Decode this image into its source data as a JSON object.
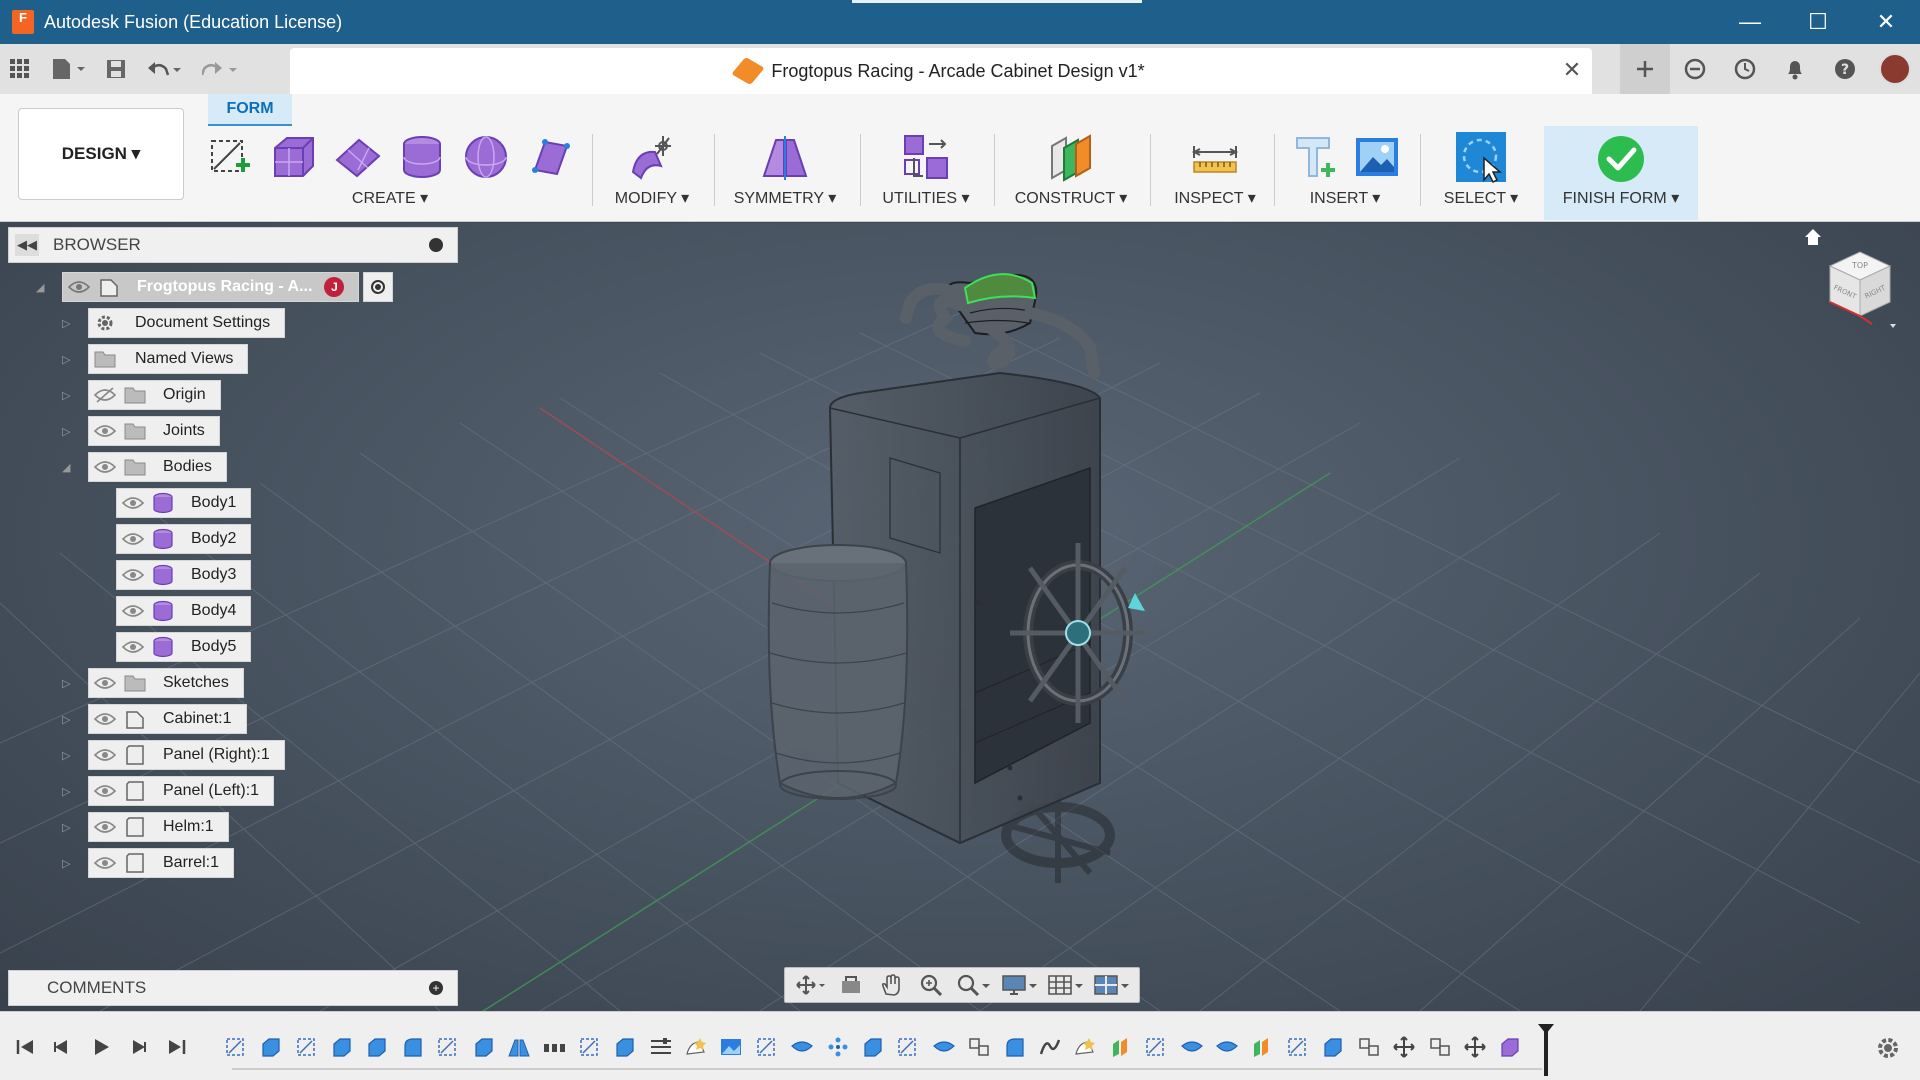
{
  "app": {
    "logo_letter": "F",
    "title": "Autodesk Fusion (Education License)"
  },
  "window_controls": {
    "minimize": "—",
    "maximize": "☐",
    "close": "✕"
  },
  "document": {
    "title": "Frogtopus Racing - Arcade Cabinet Design v1*",
    "close": "✕"
  },
  "workspace": {
    "label": "DESIGN ▾",
    "active_tab": "FORM"
  },
  "toolbar_groups": [
    {
      "label": "CREATE ▾"
    },
    {
      "label": "MODIFY ▾"
    },
    {
      "label": "SYMMETRY ▾"
    },
    {
      "label": "UTILITIES ▾"
    },
    {
      "label": "CONSTRUCT ▾"
    },
    {
      "label": "INSPECT ▾"
    },
    {
      "label": "INSERT ▾"
    },
    {
      "label": "SELECT ▾"
    },
    {
      "label": "FINISH FORM ▾"
    }
  ],
  "browser": {
    "title": "BROWSER",
    "root": {
      "label": "Frogtopus Racing - A...",
      "badge": "J"
    },
    "items": [
      {
        "label": "Document Settings"
      },
      {
        "label": "Named Views"
      },
      {
        "label": "Origin"
      },
      {
        "label": "Joints"
      },
      {
        "label": "Bodies"
      },
      {
        "label": "Body1"
      },
      {
        "label": "Body2"
      },
      {
        "label": "Body3"
      },
      {
        "label": "Body4"
      },
      {
        "label": "Body5"
      },
      {
        "label": "Sketches"
      },
      {
        "label": "Cabinet:1"
      },
      {
        "label": "Panel (Right):1"
      },
      {
        "label": "Panel (Left):1"
      },
      {
        "label": "Helm:1"
      },
      {
        "label": "Barrel:1"
      }
    ]
  },
  "comments": {
    "title": "COMMENTS",
    "add": "+"
  },
  "viewcube": {
    "top": "TOP",
    "front": "FRONT",
    "right": "RIGHT"
  },
  "colors": {
    "title_bar": "#1f5f8b",
    "accent_blue": "#0d6fb8",
    "finish_green": "#2dbd4e",
    "body_purple": "#9b6bd6",
    "viewport_bg": "#47525f"
  }
}
